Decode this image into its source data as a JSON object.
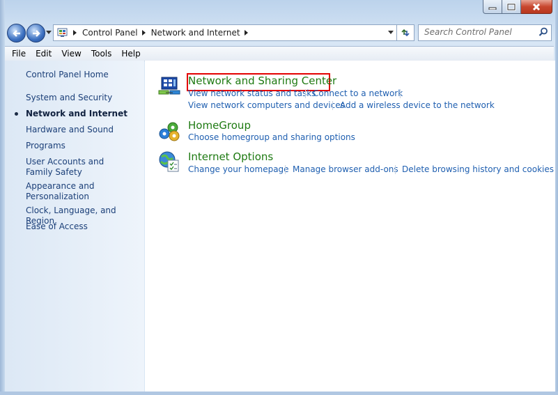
{
  "window": {
    "caption_buttons": {
      "minimize": "minimize",
      "maximize": "maximize",
      "close": "close"
    }
  },
  "address": {
    "crumbs": [
      "Control Panel",
      "Network and Internet"
    ],
    "search_placeholder": "Search Control Panel"
  },
  "menu": [
    "File",
    "Edit",
    "View",
    "Tools",
    "Help"
  ],
  "sidebar": {
    "home": "Control Panel Home",
    "items": [
      {
        "label": "System and Security"
      },
      {
        "label": "Network and Internet",
        "current": true
      },
      {
        "label": "Hardware and Sound"
      },
      {
        "label": "Programs"
      },
      {
        "label": "User Accounts and Family Safety"
      },
      {
        "label": "Appearance and Personalization"
      },
      {
        "label": "Clock, Language, and Region"
      },
      {
        "label": "Ease of Access"
      }
    ]
  },
  "categories": [
    {
      "title": "Network and Sharing Center",
      "icon": "network-sharing-icon",
      "highlighted": true,
      "links": [
        "View network status and tasks",
        "Connect to a network",
        "View network computers and devices",
        "Add a wireless device to the network"
      ]
    },
    {
      "title": "HomeGroup",
      "icon": "homegroup-icon",
      "links": [
        "Choose homegroup and sharing options"
      ]
    },
    {
      "title": "Internet Options",
      "icon": "internet-options-icon",
      "links": [
        "Change your homepage",
        "Manage browser add-ons",
        "Delete browsing history and cookies"
      ]
    }
  ],
  "colors": {
    "highlight": "#e30000",
    "category_title": "#1e7a12",
    "link": "#1f5fb0"
  }
}
